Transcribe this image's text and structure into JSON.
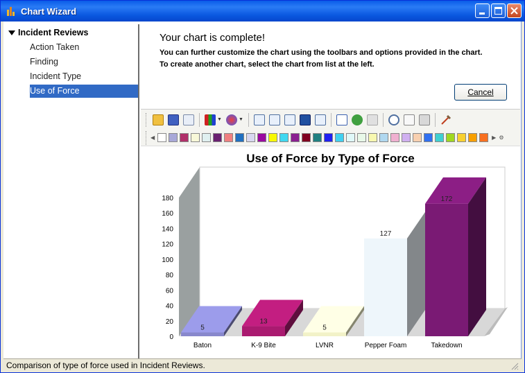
{
  "window": {
    "title": "Chart Wizard"
  },
  "sidebar": {
    "root": "Incident Reviews",
    "items": [
      {
        "label": "Action Taken"
      },
      {
        "label": "Finding"
      },
      {
        "label": "Incident Type"
      },
      {
        "label": "Use of Force",
        "selected": true
      }
    ]
  },
  "header": {
    "title": "Your chart is complete!",
    "line1": "You can further customize the chart using the toolbars and options provided in the chart.",
    "line2": "To create another chart, select the chart from list at the left.",
    "cancel_label": "Cancel"
  },
  "palette": {
    "colors": [
      "#ffffff",
      "#a8a8d8",
      "#b0306a",
      "#f8f8d8",
      "#e0f0f0",
      "#6a2070",
      "#f08080",
      "#2070c0",
      "#d8d8f0",
      "#9a0aa0",
      "#f8f800",
      "#40d8f0",
      "#8a2090",
      "#800020",
      "#208080",
      "#2020f0",
      "#40d0f0",
      "#e0f8f8",
      "#e8f8e8",
      "#f8f8b0",
      "#b0d8f0",
      "#f0b0d0",
      "#d0b0f0",
      "#f8d0b0",
      "#3070f0",
      "#40d0d0",
      "#a0d820",
      "#f8d030",
      "#f8a000",
      "#f87020",
      "#808080",
      "#5a5a90",
      "#500050",
      "#c0c0c0"
    ]
  },
  "chart_data": {
    "type": "bar",
    "title": "Use of Force by Type of Force",
    "categories": [
      "Baton",
      "K-9 Bite",
      "LVNR",
      "Pepper Foam",
      "Takedown"
    ],
    "values": [
      5,
      13,
      5,
      127,
      172
    ],
    "colors": [
      "#8888cc",
      "#aa1a70",
      "#f2f2c8",
      "#eef6fb",
      "#7a1a74"
    ],
    "y_ticks": [
      "0",
      "20",
      "40",
      "60",
      "80",
      "100",
      "120",
      "140",
      "160",
      "180"
    ],
    "ylim": [
      0,
      180
    ],
    "style": "3d",
    "grid": false,
    "legend": "none"
  },
  "status": {
    "text": "Comparison of type of force used in Incident Reviews."
  }
}
